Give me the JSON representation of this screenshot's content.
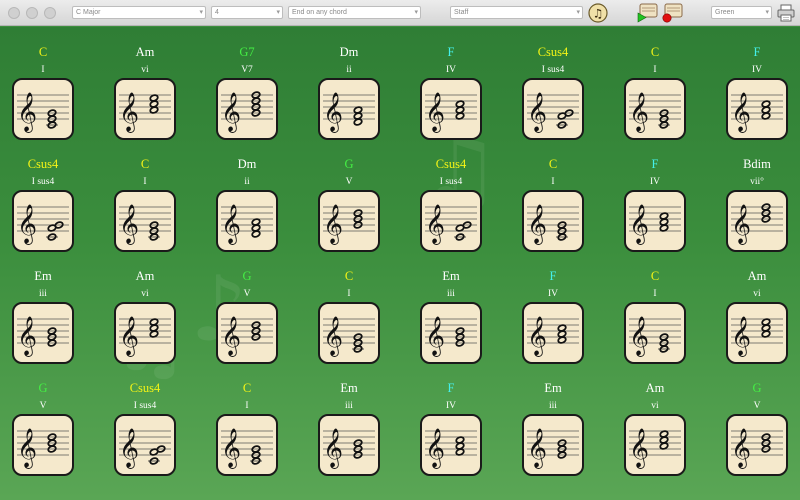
{
  "toolbar": {
    "key": "C Major",
    "count": "4",
    "ending": "End on any chord",
    "display": "Staff",
    "theme": "Green"
  },
  "colors": {
    "C": "#f4f416",
    "Am": "#ffffff",
    "G7": "#44ee44",
    "Dm": "#ffffff",
    "F": "#44f0ea",
    "Csus4": "#f4f416",
    "Bdim": "#ffffff",
    "Em": "#ffffff",
    "G": "#44ee44"
  },
  "cards": [
    {
      "name": "C",
      "roman": "I",
      "notes": [
        0,
        2,
        4
      ]
    },
    {
      "name": "Am",
      "roman": "vi",
      "notes": [
        5,
        7,
        9
      ]
    },
    {
      "name": "G7",
      "roman": "V7",
      "notes": [
        4,
        6,
        8,
        10
      ]
    },
    {
      "name": "Dm",
      "roman": "ii",
      "notes": [
        1,
        3,
        5
      ]
    },
    {
      "name": "F",
      "roman": "IV",
      "notes": [
        3,
        5,
        7
      ]
    },
    {
      "name": "Csus4",
      "roman": "I sus4",
      "notes": [
        0,
        3,
        4
      ]
    },
    {
      "name": "C",
      "roman": "I",
      "notes": [
        0,
        2,
        4
      ]
    },
    {
      "name": "F",
      "roman": "IV",
      "notes": [
        3,
        5,
        7
      ]
    },
    {
      "name": "Csus4",
      "roman": "I sus4",
      "notes": [
        0,
        3,
        4
      ]
    },
    {
      "name": "C",
      "roman": "I",
      "notes": [
        0,
        2,
        4
      ]
    },
    {
      "name": "Dm",
      "roman": "ii",
      "notes": [
        1,
        3,
        5
      ]
    },
    {
      "name": "G",
      "roman": "V",
      "notes": [
        4,
        6,
        8
      ]
    },
    {
      "name": "Csus4",
      "roman": "I sus4",
      "notes": [
        0,
        3,
        4
      ]
    },
    {
      "name": "C",
      "roman": "I",
      "notes": [
        0,
        2,
        4
      ]
    },
    {
      "name": "F",
      "roman": "IV",
      "notes": [
        3,
        5,
        7
      ]
    },
    {
      "name": "Bdim",
      "roman": "vii°",
      "notes": [
        6,
        8,
        10
      ]
    },
    {
      "name": "Em",
      "roman": "iii",
      "notes": [
        2,
        4,
        6
      ]
    },
    {
      "name": "Am",
      "roman": "vi",
      "notes": [
        5,
        7,
        9
      ]
    },
    {
      "name": "G",
      "roman": "V",
      "notes": [
        4,
        6,
        8
      ]
    },
    {
      "name": "C",
      "roman": "I",
      "notes": [
        0,
        2,
        4
      ]
    },
    {
      "name": "Em",
      "roman": "iii",
      "notes": [
        2,
        4,
        6
      ]
    },
    {
      "name": "F",
      "roman": "IV",
      "notes": [
        3,
        5,
        7
      ]
    },
    {
      "name": "C",
      "roman": "I",
      "notes": [
        0,
        2,
        4
      ]
    },
    {
      "name": "Am",
      "roman": "vi",
      "notes": [
        5,
        7,
        9
      ]
    },
    {
      "name": "G",
      "roman": "V",
      "notes": [
        4,
        6,
        8
      ]
    },
    {
      "name": "Csus4",
      "roman": "I sus4",
      "notes": [
        0,
        3,
        4
      ]
    },
    {
      "name": "C",
      "roman": "I",
      "notes": [
        0,
        2,
        4
      ]
    },
    {
      "name": "Em",
      "roman": "iii",
      "notes": [
        2,
        4,
        6
      ]
    },
    {
      "name": "F",
      "roman": "IV",
      "notes": [
        3,
        5,
        7
      ]
    },
    {
      "name": "Em",
      "roman": "iii",
      "notes": [
        2,
        4,
        6
      ]
    },
    {
      "name": "Am",
      "roman": "vi",
      "notes": [
        5,
        7,
        9
      ]
    },
    {
      "name": "G",
      "roman": "V",
      "notes": [
        4,
        6,
        8
      ]
    }
  ]
}
